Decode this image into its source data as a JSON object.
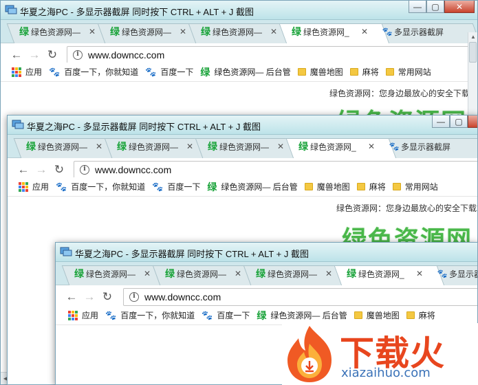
{
  "window_title": "华夏之海PC - 多显示器截屏  同时按下 CTRL + ALT + J 截图",
  "controls": {
    "minimize": "—",
    "maximize": "▢",
    "close": "✕"
  },
  "tabs": [
    {
      "icon": "绿",
      "label": "绿色资源网—",
      "close": "✕"
    },
    {
      "icon": "绿",
      "label": "绿色资源网—",
      "close": "✕"
    },
    {
      "icon": "绿",
      "label": "绿色资源网—",
      "close": "✕"
    },
    {
      "icon": "绿",
      "label": "绿色资源网_",
      "close": "✕"
    },
    {
      "icon": "paw",
      "label": "多显示器截屏",
      "close": "✕"
    }
  ],
  "nav": {
    "back": "←",
    "forward": "→",
    "reload": "↻"
  },
  "address": {
    "info": "i",
    "url": "www.downcc.com"
  },
  "bookmarks": [
    {
      "icon": "apps",
      "label": "应用"
    },
    {
      "icon": "paw",
      "label": "百度一下，你就知道"
    },
    {
      "icon": "paw",
      "label": "百度一下"
    },
    {
      "icon": "green",
      "label": "绿色资源网— 后台管"
    },
    {
      "icon": "folder",
      "label": "魔兽地图"
    },
    {
      "icon": "folder",
      "label": "麻将"
    },
    {
      "icon": "folder",
      "label": "常用网站"
    }
  ],
  "page": {
    "tagline": "绿色资源网：您身边最放心的安全下载站！",
    "big_text": "绿色资源网"
  },
  "apps_colors": [
    "#e94235",
    "#fbbc04",
    "#34a853",
    "#4285f4",
    "#e94235",
    "#fbbc04",
    "#34a853",
    "#4285f4",
    "#e94235"
  ],
  "watermark": {
    "title": "下载火",
    "url": "xiazaihuo.com",
    "color": "#e8461e"
  }
}
